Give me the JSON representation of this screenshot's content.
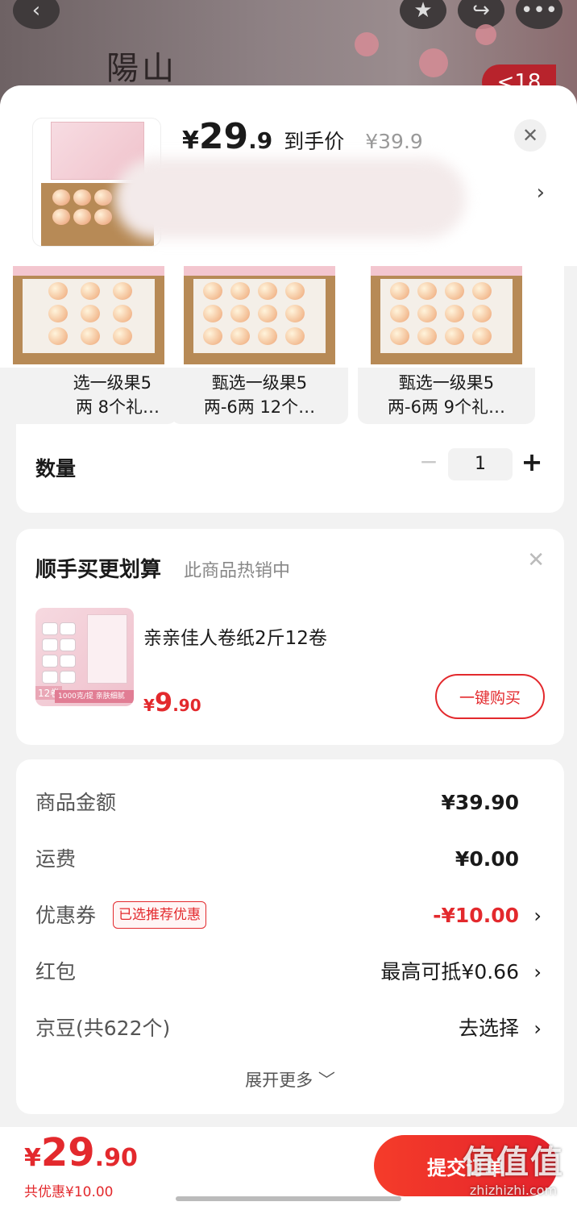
{
  "background": {
    "title_art": "陽山",
    "badge": "<18"
  },
  "header": {
    "price_symbol": "¥",
    "price_int": "29",
    "price_dec": ".9",
    "price_tag": "到手价",
    "original_price": "¥39.9",
    "close_icon": "close-icon",
    "chevron": "›"
  },
  "specs": {
    "options": [
      {
        "line1": "选一级果5",
        "line2": "两  8个礼…"
      },
      {
        "line1": "甄选一级果5",
        "line2": "两-6两  12个…"
      },
      {
        "line1": "甄选一级果5",
        "line2": "两-6两  9个礼…"
      }
    ],
    "quantity_label": "数量",
    "quantity_value": "1",
    "minus": "−",
    "plus": "+"
  },
  "upsell": {
    "title": "顺手买更划算",
    "subtitle": "此商品热销中",
    "product_name": "亲亲佳人卷纸2斤12卷",
    "price_symbol": "¥",
    "price_int": "9",
    "price_dec": ".90",
    "buy_label": "一键购买",
    "image_tag": "12卷",
    "image_band": "1000克/提 亲肤细腻"
  },
  "summary": {
    "rows": [
      {
        "label": "商品金额",
        "value": "¥39.90"
      },
      {
        "label": "运费",
        "value": "¥0.00"
      },
      {
        "label": "优惠券",
        "badge": "已选推荐优惠",
        "value": "-¥10.00"
      },
      {
        "label": "红包",
        "value": "最高可抵¥0.66"
      },
      {
        "label": "京豆(共622个)",
        "value": "去选择"
      }
    ],
    "expand_label": "展开更多 ﹀"
  },
  "bottom": {
    "total_symbol": "¥",
    "total_int": "29",
    "total_dec": ".90",
    "saved": "共优惠¥10.00",
    "submit_label": "提交订单"
  },
  "watermark": {
    "big": "值值值",
    "small": "zhizhizhi.com"
  },
  "colors": {
    "accent": "#e3292d",
    "sheet_bg": "#f2f2f2",
    "card_bg": "#ffffff"
  }
}
